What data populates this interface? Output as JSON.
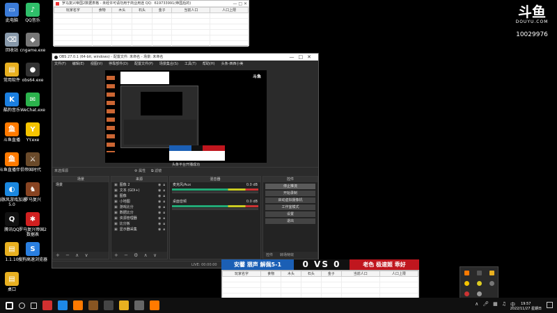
{
  "desktop": {
    "icons": [
      {
        "label": "此电脑",
        "color": "#3b7bd8",
        "glyph": "▭"
      },
      {
        "label": "QQ音乐",
        "color": "#2fbf6a",
        "glyph": "♪"
      },
      {
        "label": "回收站",
        "color": "#8899aa",
        "glyph": "⌫"
      },
      {
        "label": "cngame.exe",
        "color": "#777",
        "glyph": "◆"
      },
      {
        "label": "常用软件",
        "color": "#e8b020",
        "glyph": "▤"
      },
      {
        "label": "obs64.exe",
        "color": "#333",
        "glyph": "●"
      },
      {
        "label": "酷狗音乐",
        "color": "#1b7fe0",
        "glyph": "K"
      },
      {
        "label": "WeChat.exe",
        "color": "#2bb24c",
        "glyph": "✉"
      },
      {
        "label": "斗鱼直播",
        "color": "#ff7a00",
        "glyph": "鱼"
      },
      {
        "label": "YY.exe",
        "color": "#f5c400",
        "glyph": "Y"
      },
      {
        "label": "斗鱼直播伴侣",
        "color": "#ff7a00",
        "glyph": "鱼"
      },
      {
        "label": "帝国时代",
        "color": "#6a4a2a",
        "glyph": "⚔"
      },
      {
        "label": "海豚风游戏加速5.0",
        "color": "#1a88e0",
        "glyph": "◐"
      },
      {
        "label": "罗马复兴",
        "color": "#884422",
        "glyph": "♞"
      },
      {
        "label": "腾讯QQ",
        "color": "#111",
        "glyph": "Q"
      },
      {
        "label": "罗马复兴帝国2数据表",
        "color": "#d02020",
        "glyph": "✱"
      },
      {
        "label": "1.1.10",
        "color": "#e8b020",
        "glyph": "▤"
      },
      {
        "label": "搜狗高速浏览器",
        "color": "#2a7fe0",
        "glyph": "S"
      },
      {
        "label": "桌口",
        "color": "#e8b020",
        "glyph": "▤"
      }
    ]
  },
  "brand": {
    "logo": "斗鱼",
    "site": "DOUYU.COM",
    "room_id": "10029976"
  },
  "sheet_top": {
    "title": "罗马复兴帝国2数据表格 - 未经许可请勿用于商业用途 QQ：619733991(帝国后的)",
    "columns": [
      "玩家名字",
      "食物",
      "木头",
      "石头",
      "金子",
      "当前人口",
      "人口上限"
    ]
  },
  "sheet_bottom": {
    "columns": [
      "玩家名字",
      "食物",
      "木头",
      "石头",
      "金子",
      "当前人口",
      "人口上限"
    ]
  },
  "obs": {
    "title": "OBS 27.0.1 (64-bit, windows) - 配置文件: 未命名 - 场景: 未命名",
    "menu": [
      "文件(F)",
      "编辑(E)",
      "视图(V)",
      "停靠部件(D)",
      "配置文件(P)",
      "场景集合(S)",
      "工具(T)",
      "帮助(H)",
      "头条-西西小美"
    ],
    "scene_bar_label": "未选择源",
    "scene_bar_props": "属性",
    "scene_bar_filter": "滤镜",
    "preview_toast": "头条平台开播成功",
    "docks": {
      "scenes": {
        "header": "场景",
        "items": [
          "场景"
        ]
      },
      "sources": {
        "header": "来源",
        "items": [
          "图像 2",
          "文本 (GDI+)",
          "图像",
          "小地图",
          "游戏比分",
          "数据比分",
          "资源管理器",
          "比分板",
          "显示器采集"
        ]
      },
      "mixer": {
        "header": "混音器",
        "ch1": "麦克风/Aux",
        "ch1_db": "0.0 dB",
        "ch2": "桌面音频",
        "ch2_db": "0.0 dB"
      },
      "controls": {
        "header": "控件",
        "buttons": [
          "停止推流",
          "开始录制",
          "启动虚拟摄像机",
          "工作室模式",
          "设置",
          "退出"
        ],
        "tabs": [
          "控件",
          "转场特效"
        ]
      }
    },
    "status": {
      "live": "LIVE: 00:00:00"
    }
  },
  "banner": {
    "left": "安馨 猥声 解佩5-1",
    "score_left": "0",
    "vs": "VS",
    "score_right": "0",
    "right": "老色 极速姬 乖好"
  },
  "taskbar": {
    "clock_time": "19:57",
    "clock_date": "2022/11/27 星期日",
    "ime": "中",
    "icons": [
      {
        "name": "start-icon",
        "color": "#fff"
      },
      {
        "name": "search-icon",
        "color": "#ddd"
      },
      {
        "name": "taskview-icon",
        "color": "#ddd"
      },
      {
        "name": "excel-icon",
        "color": "#d03030"
      },
      {
        "name": "edge-icon",
        "color": "#1e88e5"
      },
      {
        "name": "douyu-icon",
        "color": "#ff7a00"
      },
      {
        "name": "game-icon",
        "color": "#885522"
      },
      {
        "name": "obs-icon",
        "color": "#444"
      },
      {
        "name": "explorer-icon",
        "color": "#e8b020"
      },
      {
        "name": "app-icon",
        "color": "#666"
      },
      {
        "name": "livestream-icon",
        "color": "#ff7a00"
      }
    ]
  }
}
